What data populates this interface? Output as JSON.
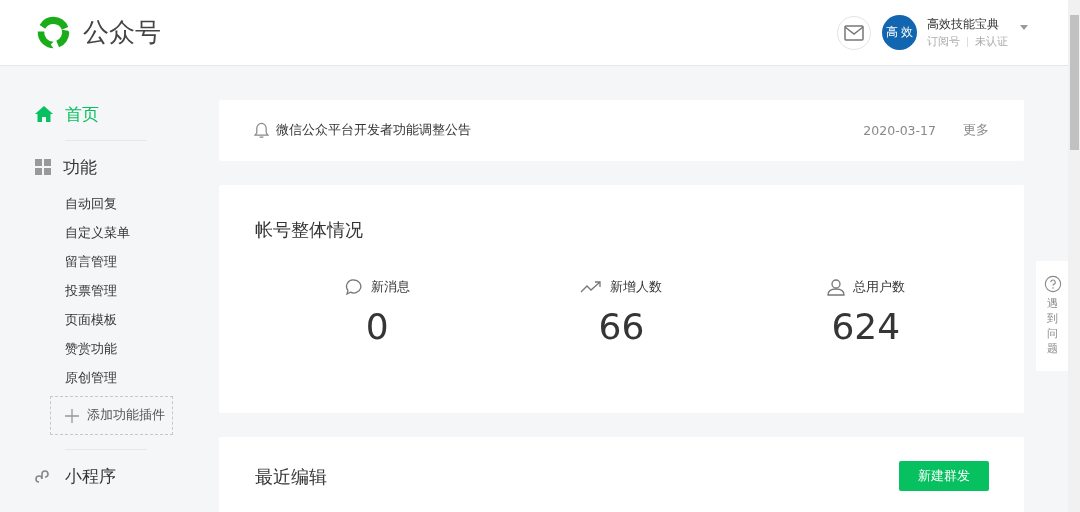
{
  "header": {
    "logo_text": "公众号",
    "avatar_text": "高 效",
    "account_name": "高效技能宝典",
    "account_type": "订阅号",
    "verification": "未认证"
  },
  "sidebar": {
    "sections": [
      {
        "title": "首页",
        "selected": true
      },
      {
        "title": "功能",
        "selected": false,
        "items": [
          {
            "label": "自动回复",
            "selected": false
          },
          {
            "label": "自定义菜单",
            "selected": false
          },
          {
            "label": "留言管理",
            "selected": false
          },
          {
            "label": "投票管理",
            "selected": false
          },
          {
            "label": "页面模板",
            "selected": false
          },
          {
            "label": "赞赏功能",
            "selected": false
          },
          {
            "label": "原创管理",
            "selected": false
          }
        ],
        "add_button": "添加功能插件"
      },
      {
        "title": "小程序",
        "selected": false
      }
    ]
  },
  "notice": {
    "text": "微信公众平台开发者功能调整公告",
    "date": "2020-03-17",
    "more": "更多"
  },
  "overview": {
    "title": "帐号整体情况",
    "stats": [
      {
        "kind": "messages",
        "label": "新消息",
        "value": "0"
      },
      {
        "kind": "growth",
        "label": "新增人数",
        "value": "66"
      },
      {
        "kind": "users",
        "label": "总用户数",
        "value": "624"
      }
    ]
  },
  "recent": {
    "title": "最近编辑",
    "button": "新建群发"
  },
  "help": {
    "text": "遇到问题"
  }
}
